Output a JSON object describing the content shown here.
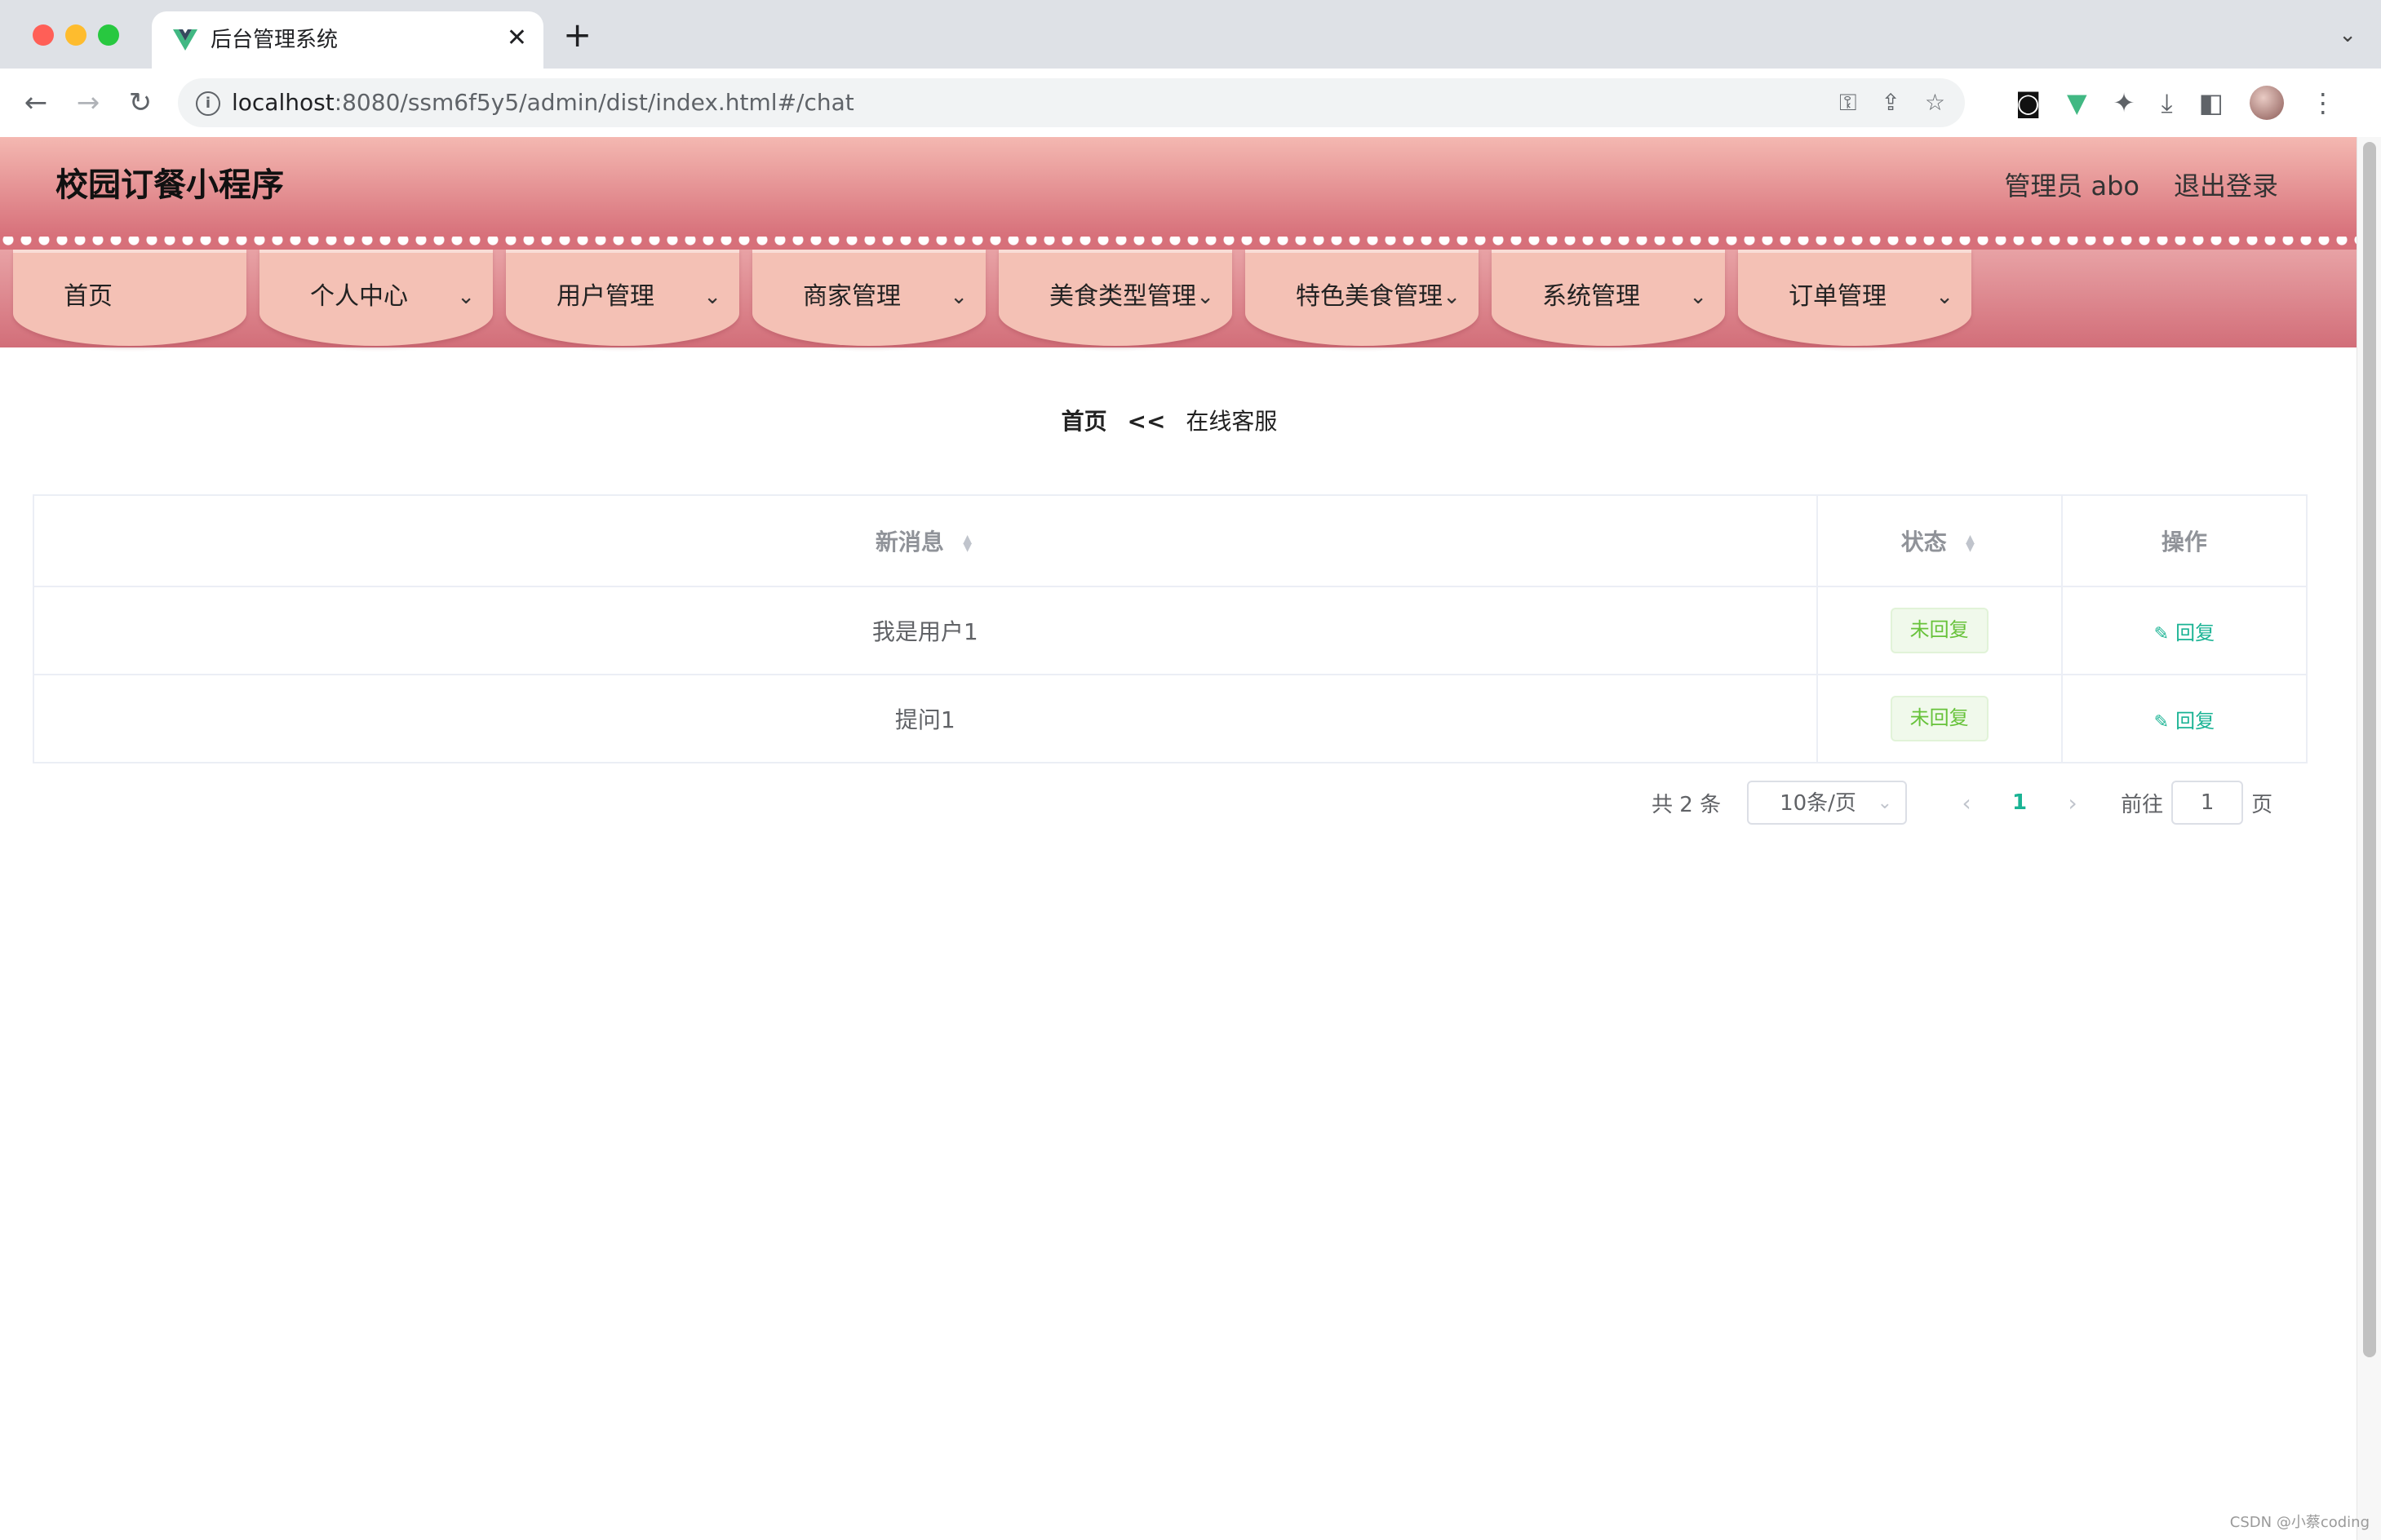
{
  "browser": {
    "tab_title": "后台管理系统",
    "tab_close": "✕",
    "new_tab": "+",
    "tab_menu": "⌄",
    "url_host": "localhost",
    "url_rest": ":8080/ssm6f5y5/admin/dist/index.html#/chat",
    "info_icon": "i",
    "back": "←",
    "forward": "→",
    "reload": "↻",
    "omnibox_icons": [
      "key-icon",
      "share-icon",
      "star-icon"
    ],
    "extension_icons": [
      "tampermonkey-icon",
      "vue-devtools-icon",
      "puzzle-icon",
      "download-icon",
      "sidepanel-icon",
      "avatar",
      "kebab-menu-icon"
    ]
  },
  "app": {
    "title": "校园订餐小程序",
    "user": "管理员 abo",
    "logout": "退出登录"
  },
  "menu": [
    {
      "label": "首页",
      "has_caret": false
    },
    {
      "label": "个人中心",
      "has_caret": true
    },
    {
      "label": "用户管理",
      "has_caret": true
    },
    {
      "label": "商家管理",
      "has_caret": true
    },
    {
      "label": "美食类型管理",
      "has_caret": true
    },
    {
      "label": "特色美食管理",
      "has_caret": true
    },
    {
      "label": "系统管理",
      "has_caret": true
    },
    {
      "label": "订单管理",
      "has_caret": true
    }
  ],
  "menu_caret": "⌄",
  "breadcrumb": {
    "home": "首页",
    "separator": "<<",
    "current": "在线客服"
  },
  "table": {
    "headers": {
      "message": "新消息",
      "status": "状态",
      "action": "操作"
    },
    "rows": [
      {
        "message": "我是用户1",
        "status": "未回复",
        "action": "回复"
      },
      {
        "message": "提问1",
        "status": "未回复",
        "action": "回复"
      }
    ]
  },
  "pagination": {
    "total": "共 2 条",
    "page_size": "10条/页",
    "current_page": "1",
    "goto_label": "前往",
    "goto_value": "1",
    "page_suffix": "页"
  },
  "watermark": "CSDN @小蔡coding",
  "colors": {
    "header_top": "#f4b8b1",
    "header_bottom": "#d7707a",
    "menu_item": "#f4c1b5",
    "accent": "#1ab394",
    "tag_green": "#67c23a"
  }
}
